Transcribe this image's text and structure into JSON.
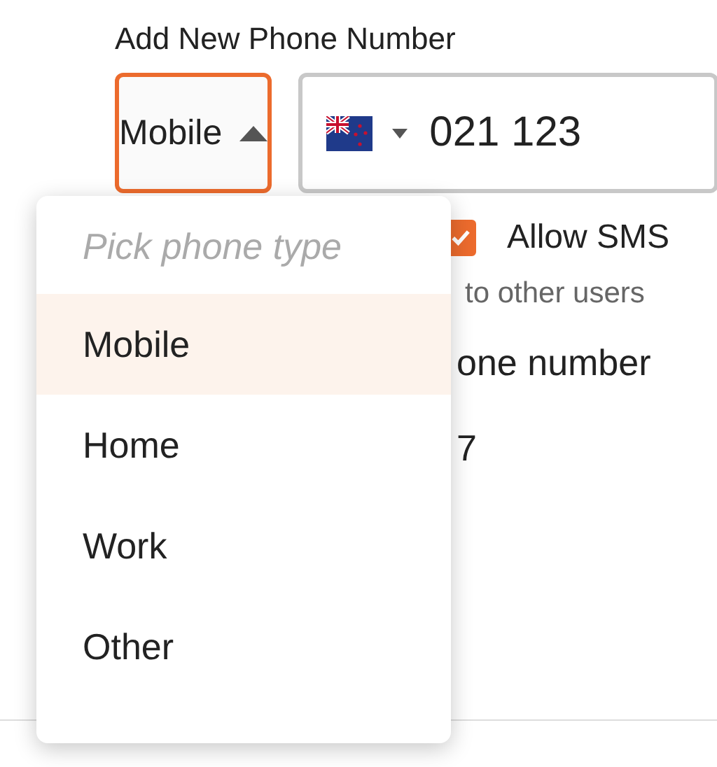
{
  "heading": "Add New Phone Number",
  "type_select": {
    "value": "Mobile",
    "expanded": true
  },
  "phone_field": {
    "value": "021 123"
  },
  "allow_sms": {
    "label": "Allow SMS",
    "checked": true
  },
  "hint": "to other users",
  "label_2": "one number",
  "text_3": "7",
  "dropdown": {
    "prompt": "Pick phone type",
    "options": [
      {
        "label": "Mobile",
        "selected": true
      },
      {
        "label": "Home",
        "selected": false
      },
      {
        "label": "Work",
        "selected": false
      },
      {
        "label": "Other",
        "selected": false
      }
    ]
  }
}
